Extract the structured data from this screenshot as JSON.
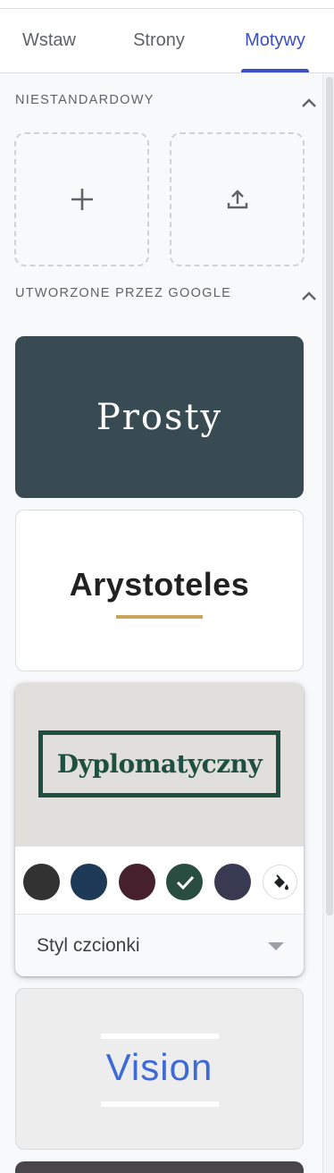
{
  "tabs": [
    {
      "label": "Wstaw"
    },
    {
      "label": "Strony"
    },
    {
      "label": "Motywy",
      "active": true
    }
  ],
  "sections": {
    "custom": {
      "title": "NIESTANDARDOWY",
      "tiles": [
        {
          "icon": "plus-icon"
        },
        {
          "icon": "upload-icon"
        }
      ]
    },
    "google": {
      "title": "UTWORZONE PRZEZ GOOGLE"
    }
  },
  "themes": {
    "prosty": {
      "name": "Prosty",
      "bg": "#384a52"
    },
    "arystoteles": {
      "name": "Arystoteles",
      "accent": "#c9a45c"
    },
    "dyplomatyczny": {
      "name": "Dyplomatyczny",
      "swatches": [
        "#323232",
        "#1e3a56",
        "#47202e",
        "#2a4d42",
        "#383a52"
      ],
      "selected_swatch": 3,
      "font_style_label": "Styl czcionki"
    },
    "vision": {
      "name": "Vision",
      "color": "#3d6ad6"
    }
  },
  "colors": {
    "accent": "#3c4fbf"
  }
}
